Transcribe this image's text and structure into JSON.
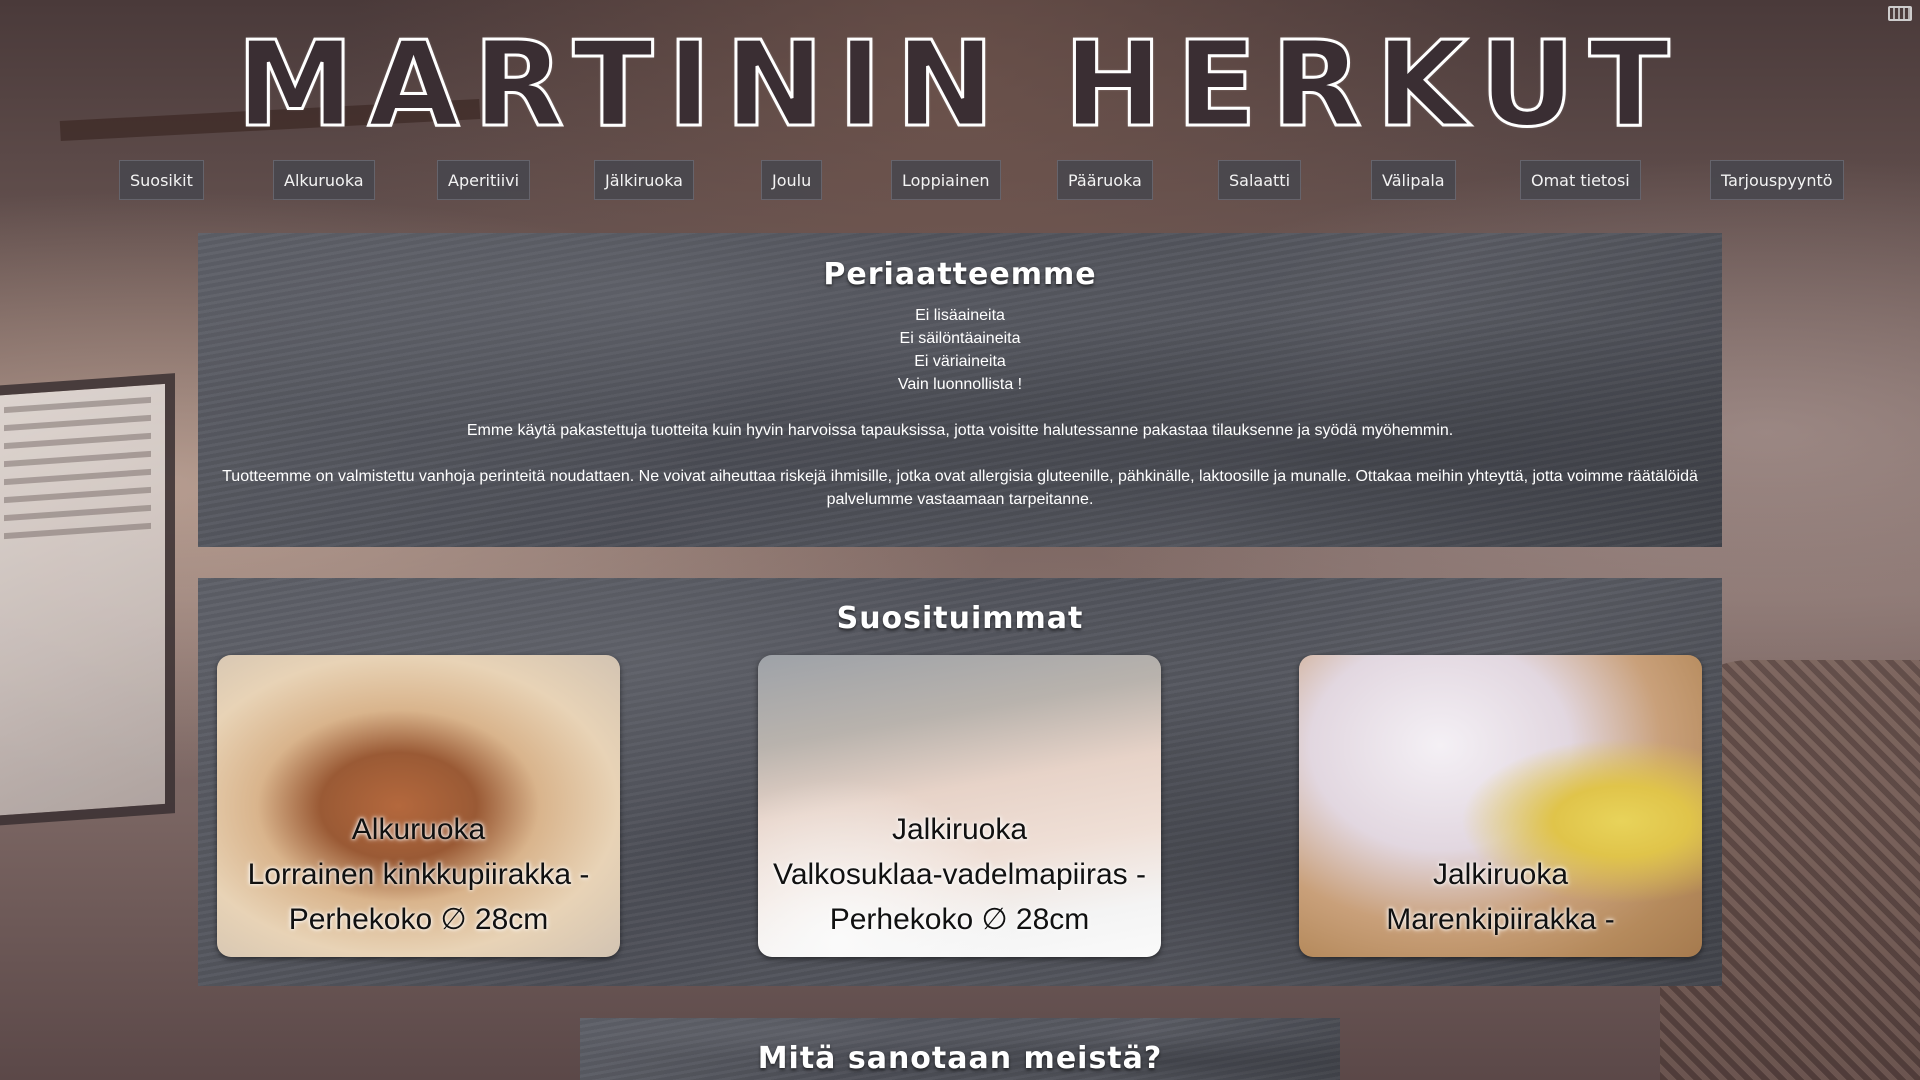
{
  "site": {
    "title": "MARTININ HERKUT"
  },
  "nav": {
    "items": [
      {
        "label": "Suosikit"
      },
      {
        "label": "Alkuruoka"
      },
      {
        "label": "Aperitiivi"
      },
      {
        "label": "Jälkiruoka"
      },
      {
        "label": "Joulu"
      },
      {
        "label": "Loppiainen"
      },
      {
        "label": "Pääruoka"
      },
      {
        "label": "Salaatti"
      },
      {
        "label": "Välipala"
      },
      {
        "label": "Omat tietosi"
      },
      {
        "label": "Tarjouspyyntö"
      }
    ]
  },
  "principles": {
    "heading": "Periaatteemme",
    "lines": [
      "Ei lisäaineita",
      "Ei säilöntäaineita",
      "Ei väriaineita",
      "Vain luonnollista !"
    ],
    "paragraph1": "Emme käytä pakastettuja tuotteita kuin hyvin harvoissa tapauksissa, jotta voisitte halutessanne pakastaa tilauksenne ja syödä myöhemmin.",
    "paragraph2": "Tuotteemme on valmistettu vanhoja perinteitä noudattaen. Ne voivat aiheuttaa riskejä ihmisille, jotka ovat allergisia gluteenille, pähkinälle, laktoosille ja munalle. Ottakaa meihin yhteyttä, jotta voimme räätälöidä palvelumme vastaamaan tarpeitanne."
  },
  "popular": {
    "heading": "Suosituimmat",
    "cards": [
      {
        "category": "Alkuruoka",
        "name": "Lorrainen kinkkupiirakka -",
        "size": "Perhekoko ∅ 28cm",
        "image": "quiche-lorraine-photo"
      },
      {
        "category": "Jalkiruoka",
        "name": "Valkosuklaa-vadelmapiiras -",
        "size": "Perhekoko ∅ 28cm",
        "image": "raspberry-pie-photo"
      },
      {
        "category": "Jalkiruoka",
        "name": "Marenkipiirakka -",
        "size": "",
        "image": "meringue-pie-photo"
      }
    ]
  },
  "testimonials": {
    "heading": "Mitä sanotaan meistä?"
  },
  "colors": {
    "slate": "#54565e",
    "title_fill": "#3a2e33",
    "nav_bg": "#46464e"
  }
}
